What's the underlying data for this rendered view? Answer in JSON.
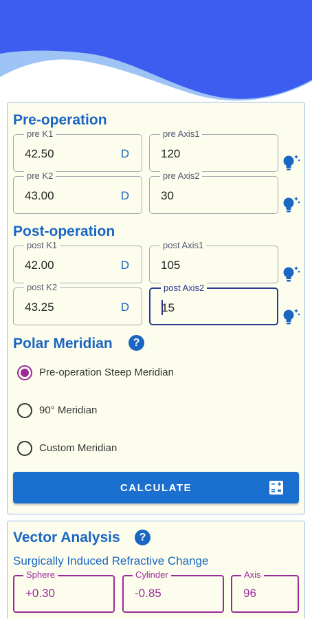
{
  "pre_operation": {
    "title": "Pre-operation",
    "pre_k1": {
      "label": "pre K1",
      "value": "42.50",
      "unit": "D"
    },
    "pre_axis1": {
      "label": "pre Axis1",
      "value": "120"
    },
    "pre_k2": {
      "label": "pre K2",
      "value": "43.00",
      "unit": "D"
    },
    "pre_axis2": {
      "label": "pre Axis2",
      "value": "30"
    }
  },
  "post_operation": {
    "title": "Post-operation",
    "post_k1": {
      "label": "post K1",
      "value": "42.00",
      "unit": "D"
    },
    "post_axis1": {
      "label": "post Axis1",
      "value": "105"
    },
    "post_k2": {
      "label": "post K2",
      "value": "43.25",
      "unit": "D"
    },
    "post_axis2": {
      "label": "post Axis2",
      "value": "15"
    }
  },
  "polar_meridian": {
    "title": "Polar Meridian",
    "options": [
      {
        "label": "Pre-operation Steep Meridian",
        "selected": true
      },
      {
        "label": "90° Meridian",
        "selected": false
      },
      {
        "label": "Custom Meridian",
        "selected": false
      }
    ]
  },
  "calculate_label": "CALCULATE",
  "vector_analysis": {
    "title": "Vector Analysis",
    "subtitle": "Surgically Induced Refractive Change",
    "sphere": {
      "label": "Sphere",
      "value": "+0.30"
    },
    "cylinder": {
      "label": "Cylinder",
      "value": "-0.85"
    },
    "axis": {
      "label": "Axis",
      "value": "96"
    }
  },
  "icons": {
    "bulb": "lightbulb-icon",
    "help": "help-icon",
    "calculator": "calculator-icon"
  },
  "colors": {
    "primary": "#1a66c2",
    "accent": "#9b2a9b",
    "header_wave_dark": "#3d5cf0",
    "header_wave_light": "#9ec4f5",
    "card_background": "#fdfdee"
  }
}
